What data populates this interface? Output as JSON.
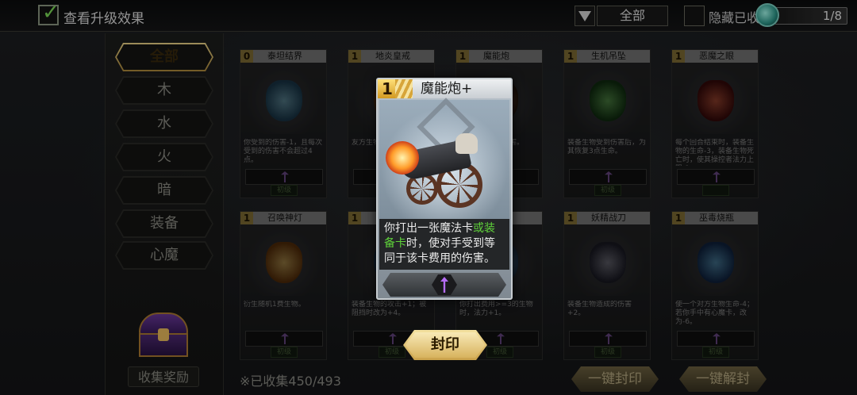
{
  "topbar": {
    "show_upgrade_label": "查看升级效果",
    "filter_value": "全部",
    "hide_collected_label": "隐藏已收",
    "page_indicator": "1/8"
  },
  "categories": [
    "全部",
    "木",
    "水",
    "火",
    "暗",
    "装备",
    "心魔"
  ],
  "active_category": "全部",
  "collection_reward_label": "收集奖励",
  "collected_text": "※已收集450/493",
  "cards_row1": [
    {
      "cost": "0",
      "name": "泰坦结界",
      "desc": "你受到的伤害-1，且每次受到的伤害不会超过4点。",
      "rarity": "初级",
      "orb_color": "#4aa0c8"
    },
    {
      "cost": "1",
      "name": "地炎皇戒",
      "desc": "友方生物…生命-2…",
      "rarity": "",
      "orb_color": "#c87a2a"
    },
    {
      "cost": "1",
      "name": "魔能炮",
      "desc": "…法卡…于该…害。",
      "rarity": "",
      "orb_color": "#7a5a4a"
    },
    {
      "cost": "1",
      "name": "生机吊坠",
      "desc": "装备生物受到伤害后，为其恢复3点生命。",
      "rarity": "初级",
      "orb_color": "#3e8a3a"
    },
    {
      "cost": "1",
      "name": "恶魔之眼",
      "desc": "每个回合结束时，装备生物的生命-3，装备生物死亡时，使其操控者法力上限-1。",
      "rarity": "",
      "orb_color": "#b8322a"
    }
  ],
  "cards_row2": [
    {
      "cost": "1",
      "name": "召唤神灯",
      "desc": "衍生随机1费生物。",
      "rarity": "初级",
      "orb_color": "#e09a2a"
    },
    {
      "cost": "1",
      "name": "…",
      "desc": "装备生物的攻击+1；被阻挡时改为+4。",
      "rarity": "初级",
      "orb_color": "#3a7ab0"
    },
    {
      "cost": "1",
      "name": "…球",
      "desc": "你打出费用>=3的生物时，法力+1。",
      "rarity": "初级",
      "orb_color": "#5a8ab0"
    },
    {
      "cost": "1",
      "name": "妖精战刀",
      "desc": "装备生物造成的伤害+2。",
      "rarity": "初级",
      "orb_color": "#6a6a7a"
    },
    {
      "cost": "1",
      "name": "巫毒烧瓶",
      "desc": "使一个对方生物生命-4；若你手中有心魔卡，改为-6。",
      "rarity": "初级",
      "orb_color": "#3a8ac8"
    }
  ],
  "popup": {
    "cost": "1",
    "name": "魔能炮+",
    "desc_before": "你打出一张魔法卡",
    "desc_highlight": "或装备卡",
    "desc_after": "时，使对手受到等同于该卡费用的伤害。",
    "highlight_color": "#5fd33a"
  },
  "seal_button_label": "封印",
  "one_key_seal_label": "一键封印",
  "one_key_unseal_label": "一键解封"
}
